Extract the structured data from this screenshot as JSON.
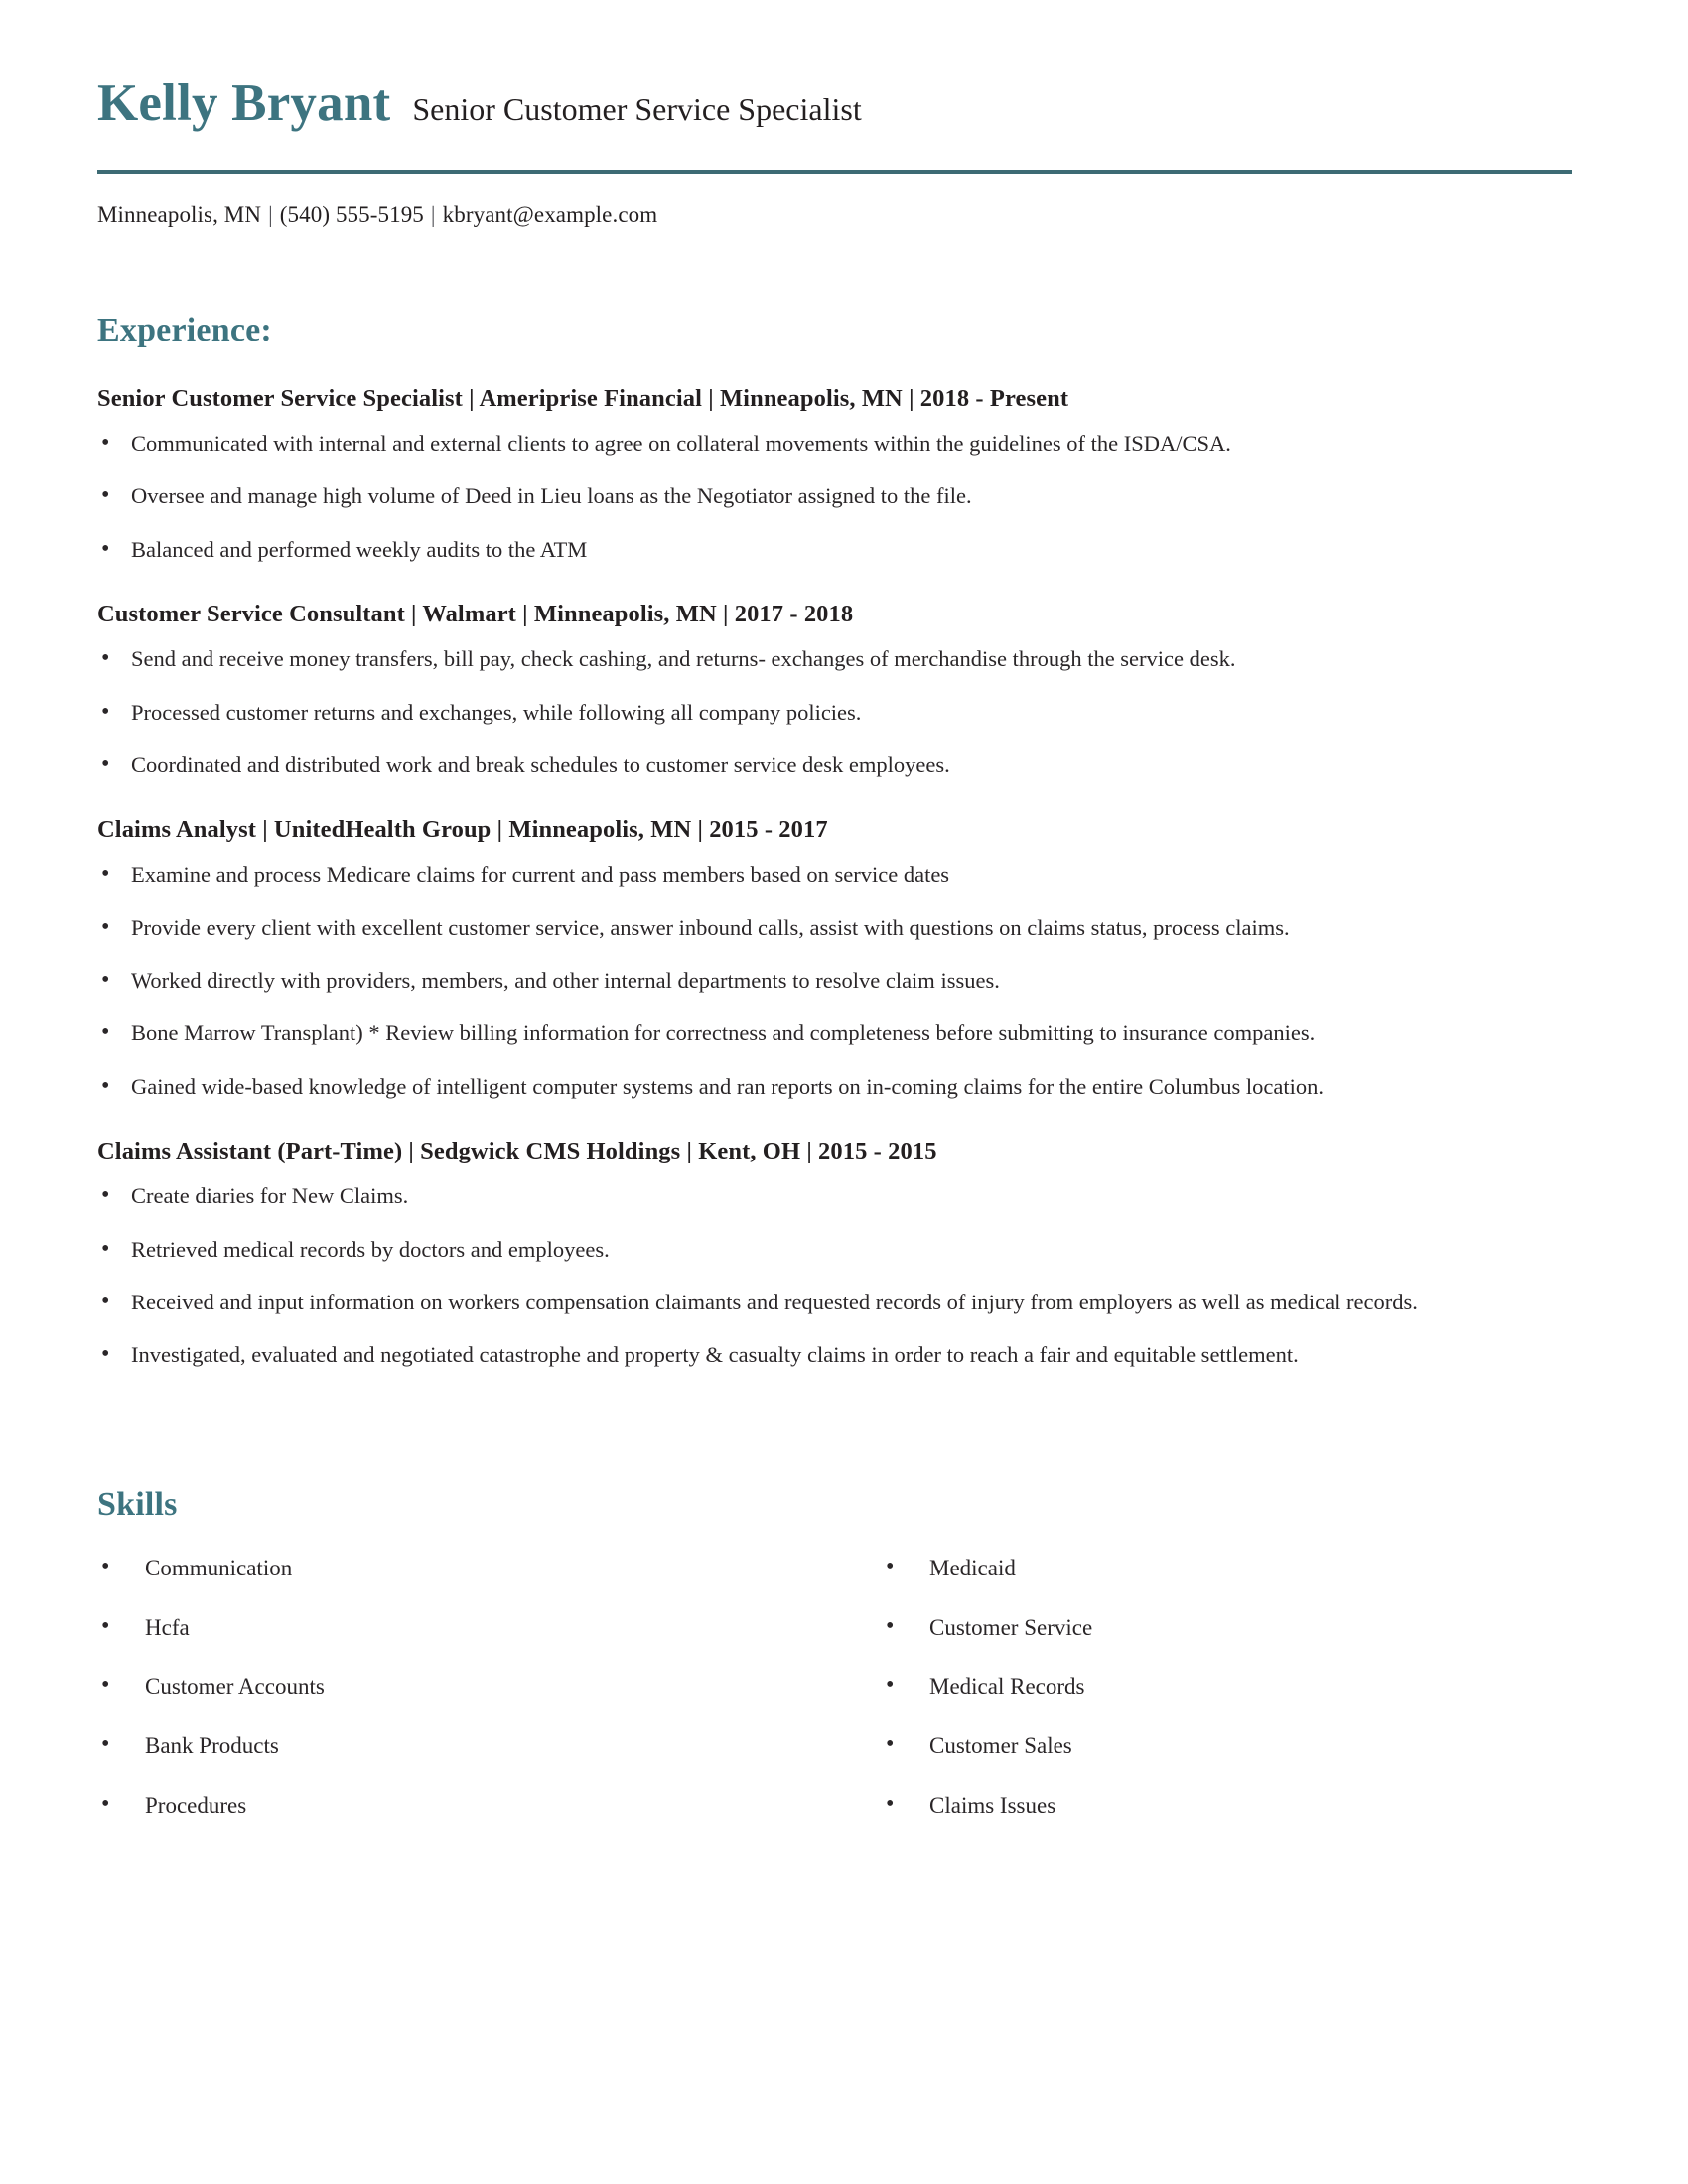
{
  "theme": {
    "accent_color": "#3d7480",
    "rule_color": "#3d6b74",
    "text_color": "#231f20",
    "background": "#ffffff"
  },
  "header": {
    "full_name": "Kelly Bryant",
    "job_title": "Senior Customer Service Specialist",
    "contact": {
      "location": "Minneapolis, MN",
      "separator_1": "|",
      "phone": "(540) 555-5195",
      "separator_2": "|",
      "email": "kbryant@example.com"
    }
  },
  "experience": {
    "section_title": "Experience:",
    "jobs": [
      {
        "heading": "Senior Customer Service Specialist | Ameriprise Financial | Minneapolis, MN | 2018 - Present",
        "title": "Senior Customer Service Specialist",
        "company": "Ameriprise Financial",
        "location": "Minneapolis, MN",
        "dates": "2018 - Present",
        "bullets": [
          "Communicated with internal and external clients to agree on collateral movements within the guidelines of the ISDA/CSA.",
          "Oversee and manage high volume of Deed in Lieu loans as the Negotiator assigned to the file.",
          "Balanced and performed weekly audits to the ATM"
        ]
      },
      {
        "heading": "Customer Service Consultant | Walmart | Minneapolis, MN | 2017 - 2018",
        "title": "Customer Service Consultant",
        "company": "Walmart",
        "location": "Minneapolis, MN",
        "dates": "2017 - 2018",
        "bullets": [
          "Send and receive money transfers, bill pay, check cashing, and returns- exchanges of merchandise through the service desk.",
          "Processed customer returns and exchanges, while following all company policies.",
          "Coordinated and distributed work and break schedules to customer service desk employees."
        ]
      },
      {
        "heading": "Claims Analyst | UnitedHealth Group | Minneapolis, MN | 2015 - 2017",
        "title": "Claims Analyst",
        "company": "UnitedHealth Group",
        "location": "Minneapolis, MN",
        "dates": "2015 - 2017",
        "bullets": [
          "Examine and process Medicare claims for current and pass members based on service dates",
          "Provide every client with excellent customer service, answer inbound calls, assist with questions on claims status, process claims.",
          "Worked directly with providers, members, and other internal departments to resolve claim issues.",
          "Bone Marrow Transplant) * Review billing information for correctness and completeness before submitting to insurance companies.",
          "Gained wide-based knowledge of intelligent computer systems and ran reports on in-coming claims for the entire Columbus location."
        ]
      },
      {
        "heading": "Claims Assistant (Part-Time) | Sedgwick CMS Holdings | Kent, OH | 2015 - 2015",
        "title": "Claims Assistant (Part-Time)",
        "company": "Sedgwick CMS Holdings",
        "location": "Kent, OH",
        "dates": "2015 - 2015",
        "bullets": [
          "Create diaries for New Claims.",
          "Retrieved medical records by doctors and employees.",
          "Received and input information on workers compensation claimants and requested records of injury from employers as well as medical records.",
          "Investigated, evaluated and negotiated catastrophe and property & casualty claims in order to reach a fair and equitable settlement."
        ]
      }
    ]
  },
  "skills": {
    "section_title": "Skills",
    "left_column": [
      "Communication",
      "Hcfa",
      "Customer Accounts",
      "Bank Products",
      "Procedures"
    ],
    "right_column": [
      "Medicaid",
      "Customer Service",
      "Medical Records",
      "Customer Sales",
      "Claims Issues"
    ]
  }
}
